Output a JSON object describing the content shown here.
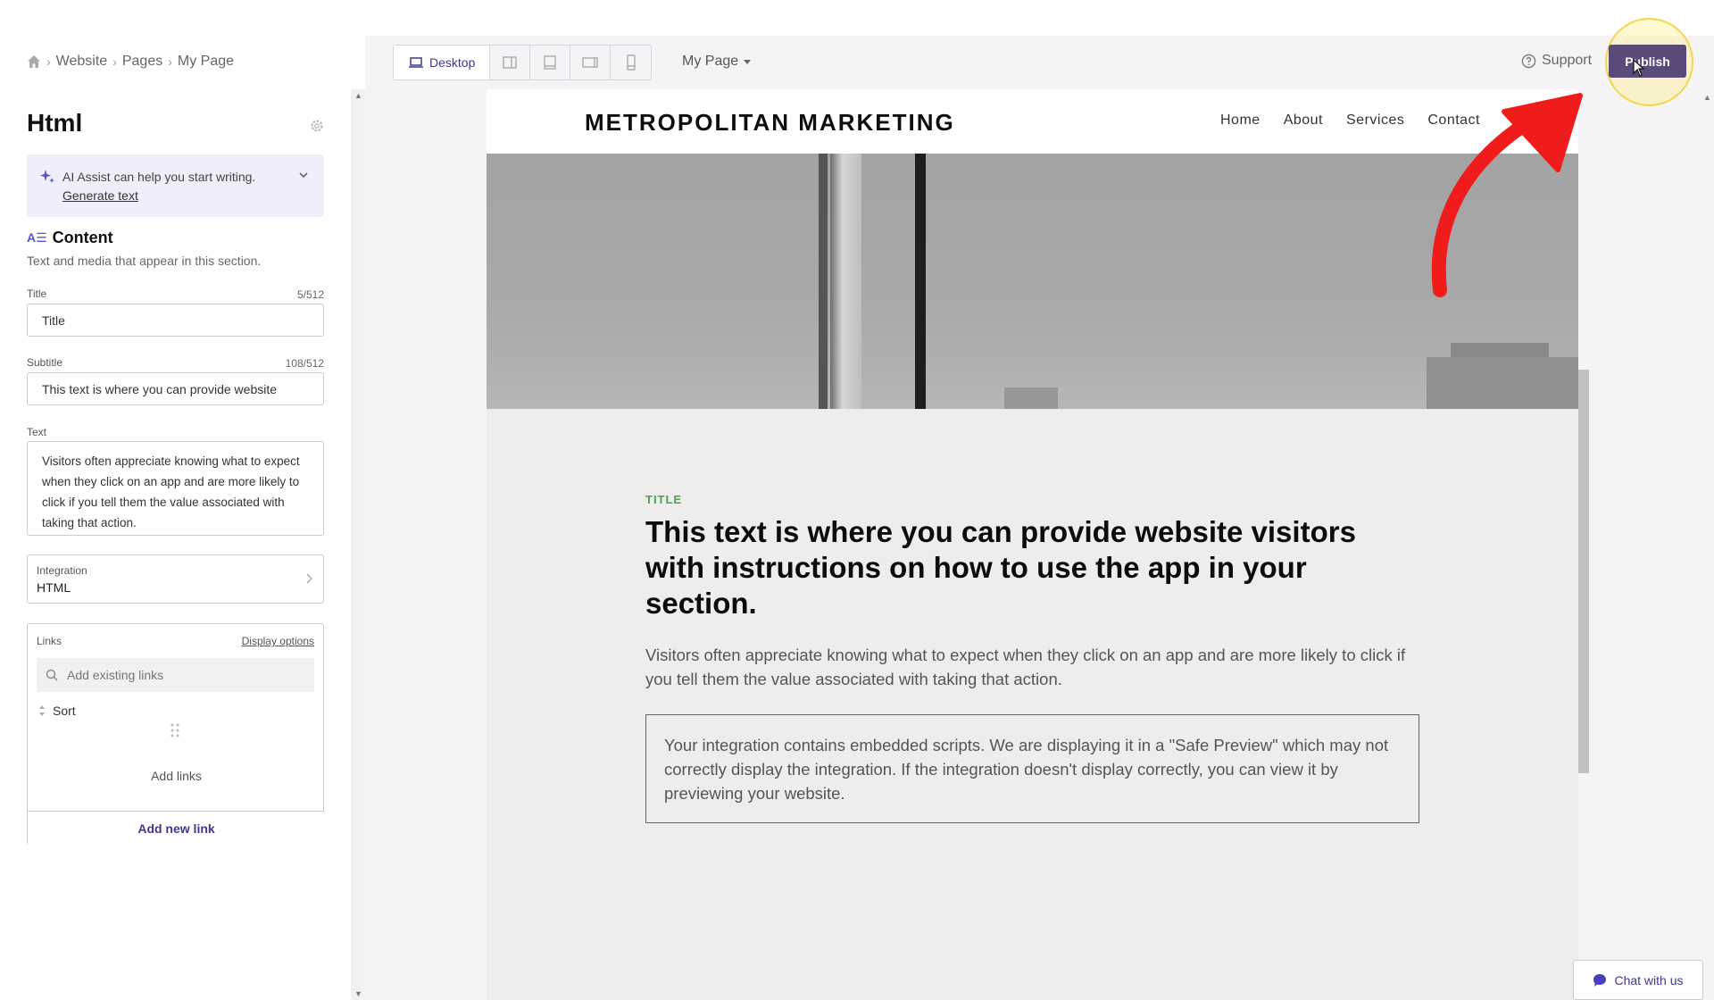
{
  "breadcrumb": {
    "items": [
      "Website",
      "Pages",
      "My Page"
    ],
    "separator": "›"
  },
  "panel": {
    "title": "Html",
    "ai_assist": {
      "text": "AI Assist can help you start writing.",
      "link": "Generate text"
    },
    "content": {
      "heading": "Content",
      "description": "Text and media that appear in this section."
    },
    "title_field": {
      "label": "Title",
      "count": "5/512",
      "value": "Title"
    },
    "subtitle_field": {
      "label": "Subtitle",
      "count": "108/512",
      "value": "This text is where you can provide website"
    },
    "text_field": {
      "label": "Text",
      "value": "Visitors often appreciate knowing what to expect when they click on an app and are more likely to click if you tell them the value associated with taking that action."
    },
    "integration": {
      "label": "Integration",
      "value": "HTML"
    },
    "links": {
      "label": "Links",
      "display_options": "Display options",
      "search_placeholder": "Add existing links",
      "sort_label": "Sort",
      "empty_text": "Add links",
      "add_new": "Add new link"
    }
  },
  "toolbar": {
    "device_desktop": "Desktop",
    "page_select": "My Page",
    "support": "Support",
    "publish": "Publish"
  },
  "site": {
    "logo": "METROPOLITAN MARKETING",
    "nav": [
      "Home",
      "About",
      "Services",
      "Contact"
    ],
    "section_label": "TITLE",
    "section_title": "This text is where you can provide website visitors with instructions on how to use the app in your section.",
    "section_body": "Visitors often appreciate knowing what to expect when they click on an app and are more likely to click if you tell them the value associated with taking that action.",
    "safe_preview": "Your integration contains embedded scripts. We are displaying it in a \"Safe Preview\" which may not correctly display the integration. If the integration doesn't display correctly, you can view it by previewing your website."
  },
  "chat": {
    "label": "Chat with us"
  },
  "colors": {
    "accent": "#3d3a8c",
    "publish": "#5a4a7a",
    "section_label": "#4aa24a",
    "annotation": "#f01c1c"
  }
}
